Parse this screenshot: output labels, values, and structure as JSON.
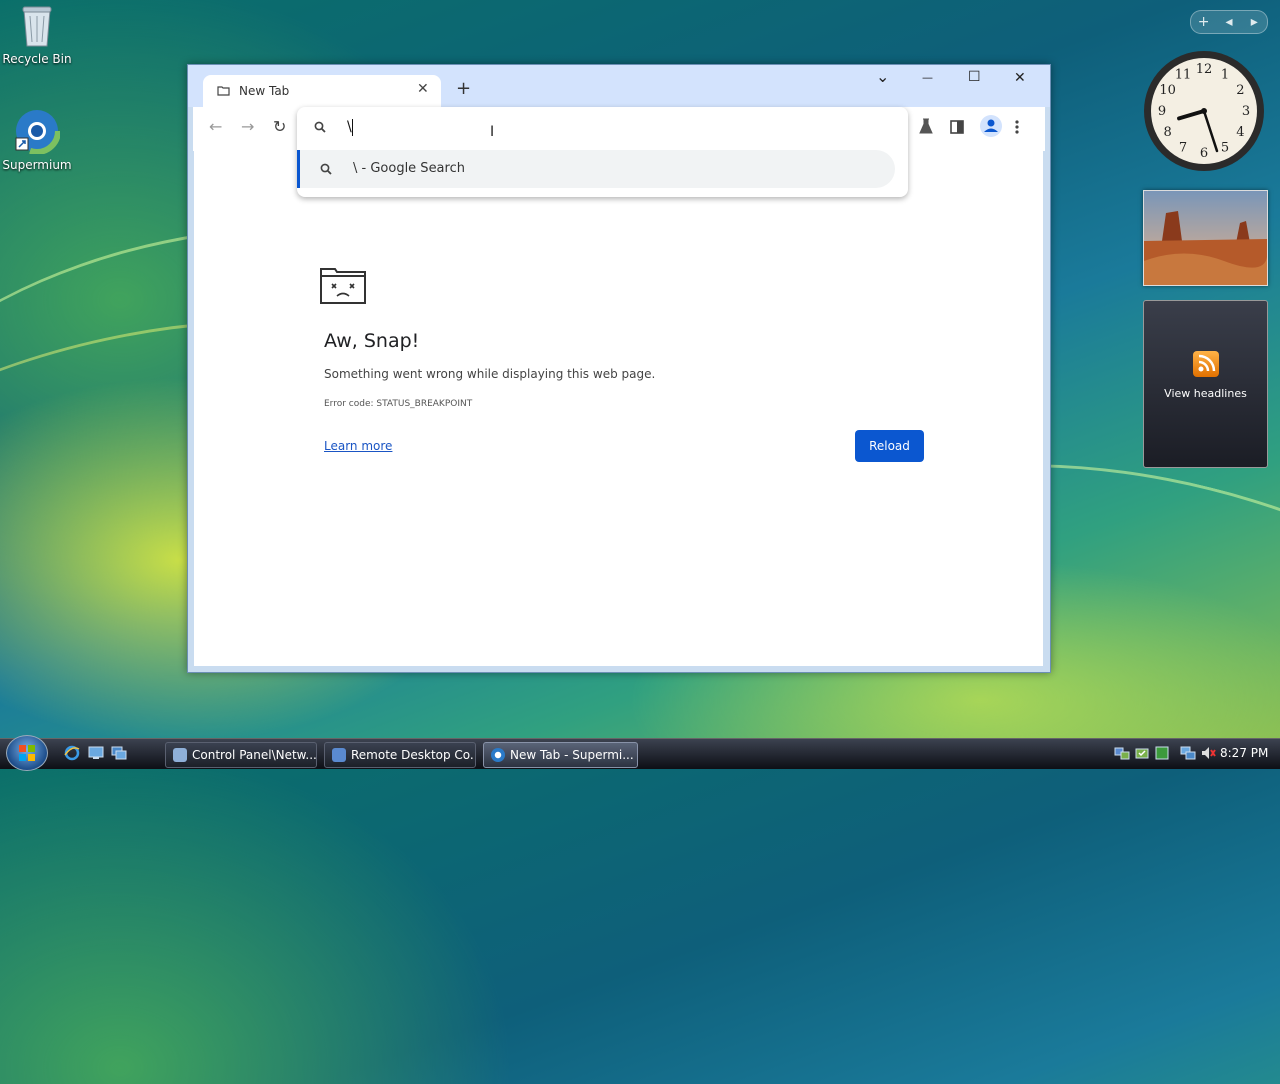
{
  "desktop": {
    "icons": [
      {
        "label": "Recycle Bin",
        "icon": "recycle-bin-icon"
      },
      {
        "label": "Supermium",
        "icon": "supermium-icon"
      }
    ],
    "gadgets": {
      "toolbar": {
        "add": "+",
        "prev": "◂",
        "next": "▸"
      },
      "clock": {
        "numbers": [
          "12",
          "1",
          "2",
          "3",
          "4",
          "5",
          "6",
          "7",
          "8",
          "9",
          "10",
          "11"
        ],
        "hour": 8,
        "minute": 27
      },
      "feed": {
        "label": "View headlines",
        "icon": "rss-icon"
      }
    }
  },
  "browser": {
    "tab": {
      "title": "New Tab",
      "close": "✕"
    },
    "new_tab": "+",
    "window_controls": {
      "menu": "⌄",
      "minimize": "—",
      "maximize": "☐",
      "close": "✕"
    },
    "omnibox": {
      "value": "\\",
      "suggestion": "\\ - Google Search"
    },
    "error_page": {
      "title": "Aw, Snap!",
      "message": "Something went wrong while displaying this web page.",
      "error_code": "Error code: STATUS_BREAKPOINT",
      "learn_more": "Learn more",
      "reload": "Reload"
    }
  },
  "taskbar": {
    "buttons": [
      {
        "label": "Control Panel\\Netw...",
        "icon": "control-panel-icon"
      },
      {
        "label": "Remote Desktop Co...",
        "icon": "remote-desktop-icon"
      },
      {
        "label": "New Tab - Supermi...",
        "icon": "supermium-icon",
        "active": true
      }
    ],
    "time": "8:27 PM"
  }
}
